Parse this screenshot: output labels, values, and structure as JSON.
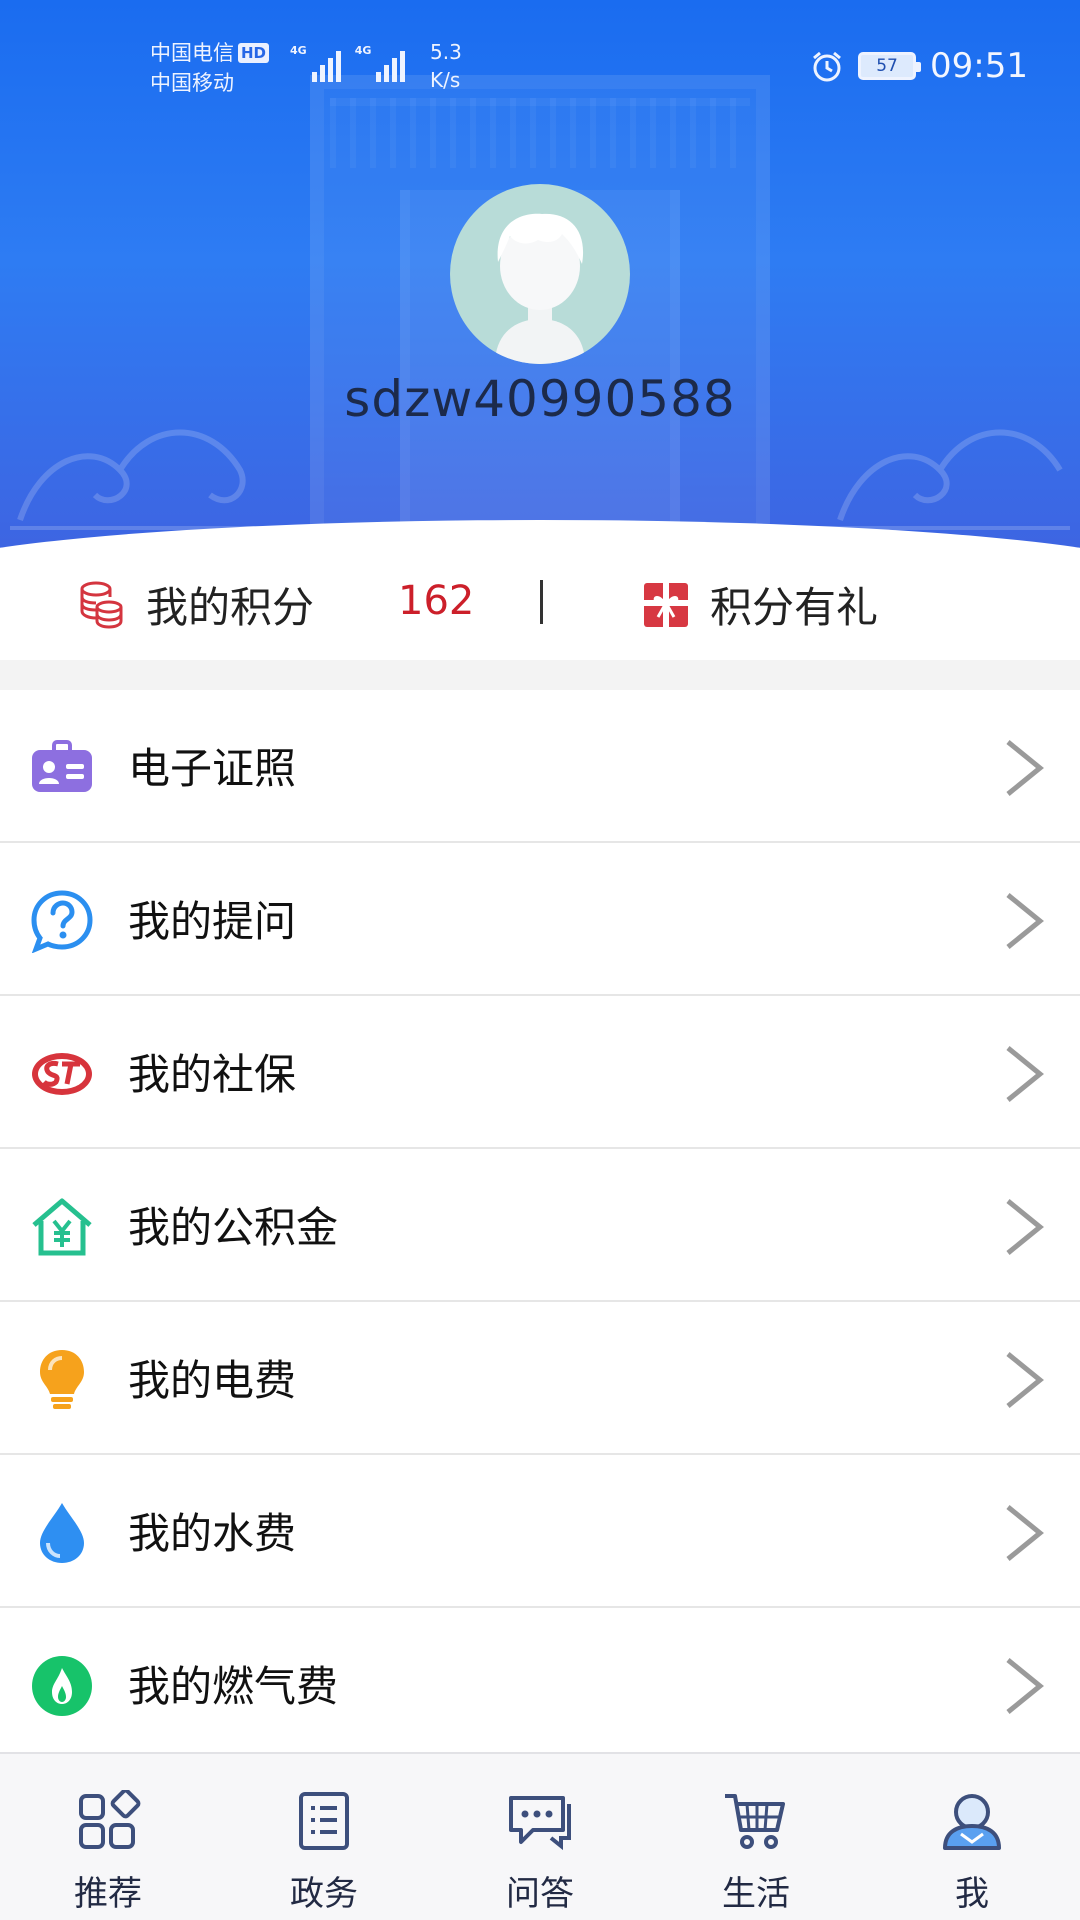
{
  "status_bar": {
    "carrier_1": "中国电信",
    "carrier_1_badge": "HD",
    "carrier_2": "中国移动",
    "network_1": "4G",
    "network_2": "4G",
    "speed_value": "5.3",
    "speed_unit": "K/s",
    "battery": "57",
    "time": "09:51"
  },
  "profile": {
    "username": "sdzw40990588"
  },
  "points": {
    "label": "我的积分",
    "value": "162",
    "gift_label": "积分有礼"
  },
  "menu": {
    "items": [
      {
        "label": "电子证照",
        "icon": "id-card-icon"
      },
      {
        "label": "我的提问",
        "icon": "question-bubble-icon"
      },
      {
        "label": "我的社保",
        "icon": "social-security-icon"
      },
      {
        "label": "我的公积金",
        "icon": "housing-fund-icon"
      },
      {
        "label": "我的电费",
        "icon": "lightbulb-icon"
      },
      {
        "label": "我的水费",
        "icon": "water-drop-icon"
      },
      {
        "label": "我的燃气费",
        "icon": "gas-flame-icon"
      }
    ]
  },
  "tabs": [
    {
      "label": "推荐",
      "icon": "grid-icon",
      "active": false
    },
    {
      "label": "政务",
      "icon": "document-list-icon",
      "active": false
    },
    {
      "label": "问答",
      "icon": "chat-icon",
      "active": false
    },
    {
      "label": "生活",
      "icon": "shopping-cart-icon",
      "active": false
    },
    {
      "label": "我",
      "icon": "user-icon",
      "active": true
    }
  ],
  "colors": {
    "header_blue": "#1a6cf0",
    "points_red": "#cc1f2a",
    "tab_icon": "#3d4f7c"
  }
}
